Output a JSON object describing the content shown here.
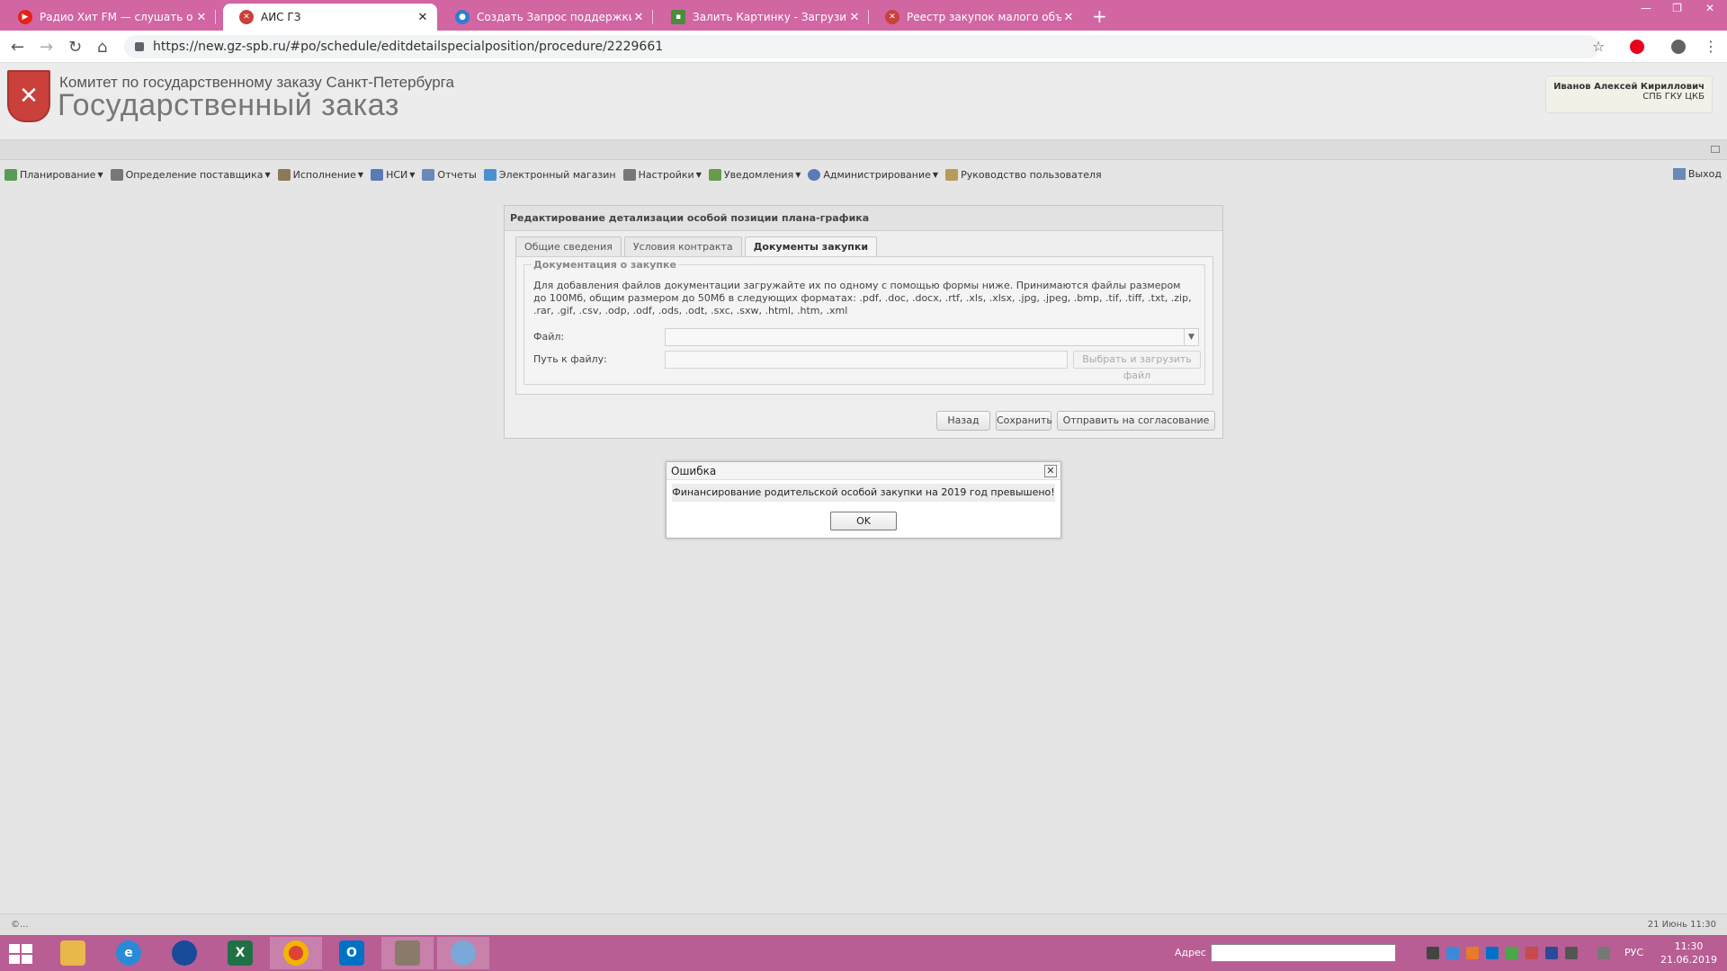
{
  "browser": {
    "tabs": [
      {
        "title": "Радио Хит FM — слушать о",
        "active": false,
        "favicon_color": "#e62117"
      },
      {
        "title": "АИС ГЗ",
        "active": true,
        "favicon_color": "#c9413a"
      },
      {
        "title": "Создать Запрос поддержки - А",
        "active": false,
        "favicon_color": "#2a7fd4"
      },
      {
        "title": "Залить Картинку - Загрузить ф",
        "active": false,
        "favicon_color": "#4a8c3a"
      },
      {
        "title": "Реестр закупок малого объема",
        "active": false,
        "favicon_color": "#c9413a"
      }
    ],
    "url": "https://new.gz-spb.ru/#po/schedule/editdetailspecialposition/procedure/2229661"
  },
  "header": {
    "org": "Комитет по государственному заказу Санкт-Петербурга",
    "app_name": "Государственный заказ",
    "user_name": "Иванов Алексей Кириллович",
    "user_org": "СПБ ГКУ ЦКБ"
  },
  "menu": {
    "items": [
      {
        "label": "Планирование",
        "icon": "planning-icon",
        "dropdown": true,
        "color": "#5a9a5a"
      },
      {
        "label": "Определение поставщика",
        "icon": "supplier-icon",
        "dropdown": true,
        "color": "#777777"
      },
      {
        "label": "Исполнение",
        "icon": "execution-icon",
        "dropdown": true,
        "color": "#8a7a5a"
      },
      {
        "label": "НСИ",
        "icon": "nsi-icon",
        "dropdown": true,
        "color": "#5a7ab8"
      },
      {
        "label": "Отчеты",
        "icon": "reports-icon",
        "dropdown": false,
        "color": "#6a88b8"
      },
      {
        "label": "Электронный магазин",
        "icon": "shop-icon",
        "dropdown": false,
        "color": "#4a90d0"
      },
      {
        "label": "Настройки",
        "icon": "settings-icon",
        "dropdown": true,
        "color": "#777777"
      },
      {
        "label": "Уведомления",
        "icon": "notifications-icon",
        "dropdown": true,
        "color": "#6a9a4a"
      },
      {
        "label": "Администрирование",
        "icon": "admin-icon",
        "dropdown": true,
        "color": "#5a7ab8"
      },
      {
        "label": "Руководство пользователя",
        "icon": "manual-icon",
        "dropdown": false,
        "color": "#b89a5a"
      }
    ],
    "logout": "Выход"
  },
  "panel": {
    "title": "Редактирование детализации особой позиции плана-графика",
    "tabs": [
      "Общие сведения",
      "Условия контракта",
      "Документы закупки"
    ],
    "active_tab": "Документы закупки",
    "fieldset_legend": "Документация о закупке",
    "info": "Для добавления файлов документации загружайте их по одному с помощью формы ниже. Принимаются файлы размером до 100Мб, общим размером до 50Мб в следующих форматах: .pdf, .doc, .docx, .rtf, .xls, .xlsx, .jpg, .jpeg, .bmp, .tif, .tiff, .txt, .zip, .rar, .gif, .csv, .odp, .odf, .ods, .odt, .sxc, .sxw, .html, .htm, .xml",
    "file_label": "Файл:",
    "path_label": "Путь к файлу:",
    "upload_label": "Выбрать и загрузить файл",
    "buttons": {
      "back": "Назад",
      "save": "Сохранить",
      "send": "Отправить на согласование"
    }
  },
  "dialog": {
    "title": "Ошибка",
    "message": "Финансирование родительской особой закупки на 2019 год превышено!",
    "ok": "OK"
  },
  "status": {
    "left": "©...",
    "right": "21 Июнь 11:30"
  },
  "taskbar": {
    "address_label": "Адрес",
    "lang": "РУС",
    "time": "11:30",
    "date": "21.06.2019"
  }
}
